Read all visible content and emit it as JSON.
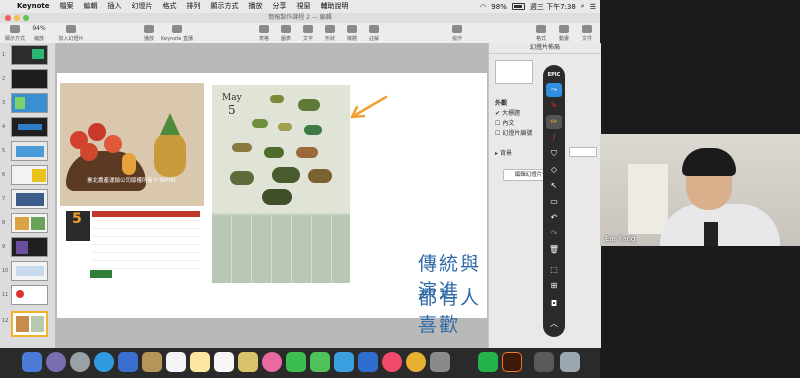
{
  "menubar": {
    "app_name": "Keynote",
    "items": [
      "檔案",
      "編輯",
      "插入",
      "幻燈片",
      "格式",
      "排列",
      "顯示方式",
      "播放",
      "分享",
      "視窗",
      "輔助說明"
    ],
    "battery": "98%",
    "clock": "週三 下午7:38"
  },
  "window": {
    "title": "簡報製作課程 2 — 編輯"
  },
  "toolbar": {
    "zoom_value": "94%",
    "buttons": [
      "顯示方式",
      "縮放",
      "加入幻燈片",
      "播放",
      "Keynote 直播",
      "表格",
      "圖表",
      "文字",
      "形狀",
      "媒體",
      "註解",
      "協作",
      "格式",
      "動畫",
      "文件"
    ]
  },
  "navigator": {
    "slide_numbers": [
      "1",
      "2",
      "3",
      "4",
      "5",
      "6",
      "7",
      "8",
      "9",
      "10",
      "11",
      "12"
    ]
  },
  "slide": {
    "left_calendar_caption": "臺北農產運銷公司版權所有©TAPMC",
    "left_calendar_month": "5",
    "right_calendar_month_name": "May",
    "right_calendar_day": "5",
    "caption_line1": "傳統與演進",
    "caption_line2": "都有人喜歡"
  },
  "inspector": {
    "header": "幻燈片佈局",
    "section_appearance": "外觀",
    "checkbox_title": "大標題",
    "checkbox_body": "內文",
    "checkbox_slide_number": "幻燈片編號",
    "section_background": "背景",
    "edit_button": "編輯幻燈片佈局"
  },
  "pen_toolbar": {
    "mode_label": "EPIC"
  },
  "webcam": {
    "name": "Ear Fang"
  },
  "colors": {
    "caption_blue": "#2f6aa6",
    "arrow_orange": "#f0a030",
    "slide_bg": "#ffffff"
  }
}
